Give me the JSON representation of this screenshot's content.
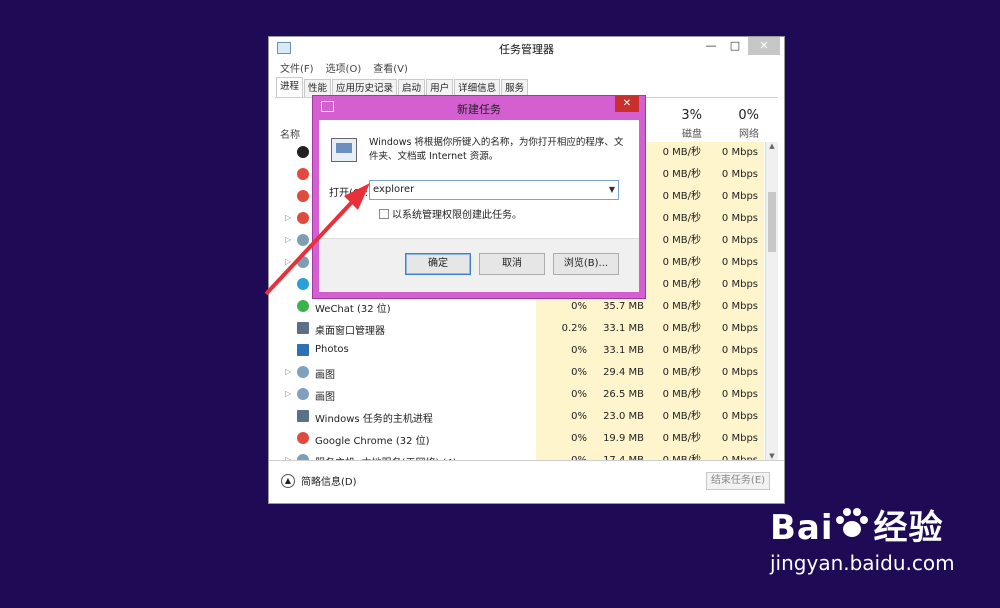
{
  "window": {
    "title": "任务管理器",
    "min": "—",
    "max": "□",
    "close": "✕",
    "menu": [
      "文件(F)",
      "选项(O)",
      "查看(V)"
    ],
    "tabs": [
      "进程",
      "性能",
      "应用历史记录",
      "启动",
      "用户",
      "详细信息",
      "服务"
    ]
  },
  "columns": {
    "name": "名称",
    "disk_pct": "3%",
    "disk": "磁盘",
    "net_pct": "0%",
    "net": "网络"
  },
  "processes": [
    {
      "name": "",
      "icon": "qq-icon",
      "cpu": "",
      "mem": "",
      "disk": "0 MB/秒",
      "net": "0 Mbps",
      "expand": false
    },
    {
      "name": "",
      "icon": "chrome-icon",
      "cpu": "",
      "mem": "",
      "disk": "0 MB/秒",
      "net": "0 Mbps",
      "expand": false
    },
    {
      "name": "",
      "icon": "chrome-icon",
      "cpu": "",
      "mem": "",
      "disk": "0 MB/秒",
      "net": "0 Mbps",
      "expand": false
    },
    {
      "name": "",
      "icon": "chrome-icon",
      "cpu": "",
      "mem": "",
      "disk": "0 MB/秒",
      "net": "0 Mbps",
      "expand": true
    },
    {
      "name": "",
      "icon": "service-icon",
      "cpu": "",
      "mem": "",
      "disk": "0 MB/秒",
      "net": "0 Mbps",
      "expand": true
    },
    {
      "name": "",
      "icon": "service-icon",
      "cpu": "",
      "mem": "",
      "disk": "0 MB/秒",
      "net": "0 Mbps",
      "expand": true
    },
    {
      "name": "",
      "icon": "globe-icon",
      "cpu": "",
      "mem": "",
      "disk": "0 MB/秒",
      "net": "0 Mbps",
      "expand": false
    },
    {
      "name": "WeChat (32 位)",
      "icon": "wechat-icon",
      "cpu": "0%",
      "mem": "35.7 MB",
      "disk": "0 MB/秒",
      "net": "0 Mbps",
      "expand": false
    },
    {
      "name": "桌面窗口管理器",
      "icon": "window-icon",
      "cpu": "0.2%",
      "mem": "33.1 MB",
      "disk": "0 MB/秒",
      "net": "0 Mbps",
      "expand": false
    },
    {
      "name": "Photos",
      "icon": "photos-icon",
      "cpu": "0%",
      "mem": "33.1 MB",
      "disk": "0 MB/秒",
      "net": "0 Mbps",
      "expand": false
    },
    {
      "name": "画图",
      "icon": "paint-icon",
      "cpu": "0%",
      "mem": "29.4 MB",
      "disk": "0 MB/秒",
      "net": "0 Mbps",
      "expand": true
    },
    {
      "name": "画图",
      "icon": "paint-icon",
      "cpu": "0%",
      "mem": "26.5 MB",
      "disk": "0 MB/秒",
      "net": "0 Mbps",
      "expand": true
    },
    {
      "name": "Windows 任务的主机进程",
      "icon": "window-icon",
      "cpu": "0%",
      "mem": "23.0 MB",
      "disk": "0 MB/秒",
      "net": "0 Mbps",
      "expand": false
    },
    {
      "name": "Google Chrome (32 位)",
      "icon": "chrome-icon",
      "cpu": "0%",
      "mem": "19.9 MB",
      "disk": "0 MB/秒",
      "net": "0 Mbps",
      "expand": false
    },
    {
      "name": "服务主机: 本地服务(无网络) (4)",
      "icon": "service-icon",
      "cpu": "0%",
      "mem": "17.4 MB",
      "disk": "0 MB/秒",
      "net": "0 Mbps",
      "expand": true
    }
  ],
  "footer": {
    "fewer_details": "简略信息(D)",
    "end_task": "结束任务(E)"
  },
  "dialog": {
    "title": "新建任务",
    "close": "✕",
    "description": "Windows 将根据你所键入的名称，为你打开相应的程序、文件夹、文档或 Internet 资源。",
    "open_label": "打开(O):",
    "open_value": "explorer",
    "admin_label": "以系统管理权限创建此任务。",
    "ok": "确定",
    "cancel": "取消",
    "browse": "浏览(B)..."
  },
  "watermark": {
    "logo_left": "Bai",
    "logo_right": "经验",
    "url": "jingyan.baidu.com"
  },
  "colors": {
    "desktop": "#1e0a55",
    "dialog_frame": "#d45fd0",
    "arrow": "#e8303a",
    "heat": "#fff5cc"
  }
}
